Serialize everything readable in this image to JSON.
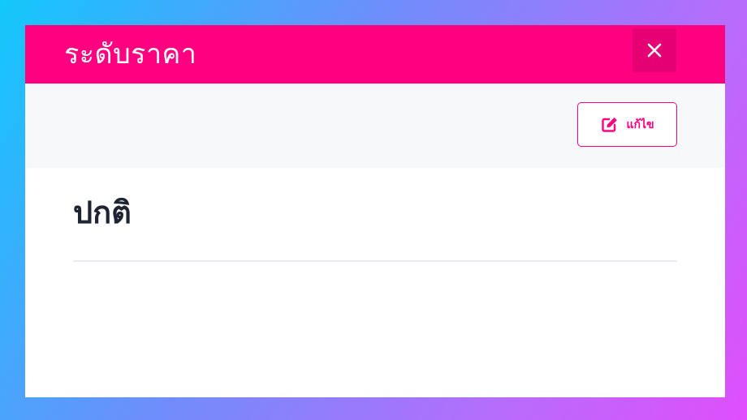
{
  "modal": {
    "title": "ระดับราคา",
    "close_icon": "close-icon",
    "edit_button": {
      "label": "แก้ไข",
      "icon": "edit-icon"
    },
    "value": "ปกติ"
  },
  "colors": {
    "header_bg": "#ff0080",
    "accent": "#ff0080",
    "toolbar_bg": "#f7f8fa",
    "value_text": "#1f2433",
    "divider": "#e8ebf0"
  }
}
